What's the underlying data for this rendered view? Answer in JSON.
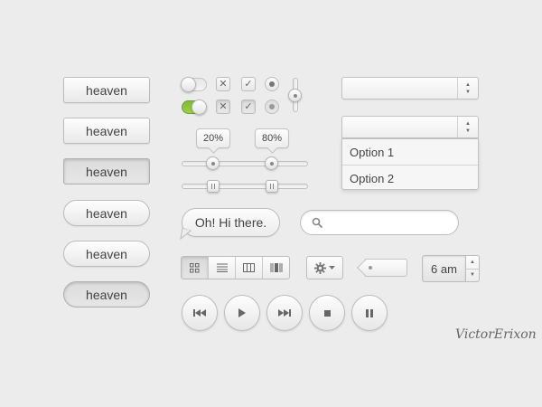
{
  "buttons": [
    {
      "label": "heaven",
      "style": "square",
      "state": "normal"
    },
    {
      "label": "heaven",
      "style": "square",
      "state": "normal"
    },
    {
      "label": "heaven",
      "style": "square",
      "state": "pressed"
    },
    {
      "label": "heaven",
      "style": "pill",
      "state": "normal"
    },
    {
      "label": "heaven",
      "style": "pill",
      "state": "normal"
    },
    {
      "label": "heaven",
      "style": "pill",
      "state": "pressed"
    }
  ],
  "toggles": [
    {
      "state": "off"
    },
    {
      "state": "on",
      "color": "#8cc63f"
    }
  ],
  "checkboxes": [
    {
      "icon": "x-icon",
      "glyph": "✕",
      "state": "normal"
    },
    {
      "icon": "check-icon",
      "glyph": "✓",
      "state": "normal"
    },
    {
      "icon": "x-icon",
      "glyph": "✕",
      "state": "active"
    },
    {
      "icon": "check-icon",
      "glyph": "✓",
      "state": "active"
    }
  ],
  "radios": [
    {
      "state": "normal"
    },
    {
      "state": "active"
    }
  ],
  "slider_tooltips": {
    "left": "20%",
    "right": "80%"
  },
  "range_slider": {
    "low": 20,
    "high": 80
  },
  "selects": {
    "top": {
      "value": ""
    },
    "open": {
      "value": "",
      "options": [
        "Option 1",
        "Option 2"
      ]
    }
  },
  "speech_bubble": {
    "text": "Oh! Hi there."
  },
  "search": {
    "placeholder": "",
    "value": "",
    "icon": "search-icon"
  },
  "view_switcher": [
    {
      "icon": "grid-view-icon",
      "active": true
    },
    {
      "icon": "list-view-icon",
      "active": false
    },
    {
      "icon": "columns-view-icon",
      "active": false
    },
    {
      "icon": "coverflow-view-icon",
      "active": false
    }
  ],
  "settings_button": {
    "icon": "gear-icon",
    "caret": "chevron-down-icon"
  },
  "tag": {
    "label": ""
  },
  "time_stepper": {
    "value": "6 am"
  },
  "media_controls": [
    {
      "icon": "previous-icon"
    },
    {
      "icon": "play-icon"
    },
    {
      "icon": "next-icon"
    },
    {
      "icon": "stop-icon"
    },
    {
      "icon": "pause-icon"
    }
  ],
  "signature": "VictorErixon"
}
